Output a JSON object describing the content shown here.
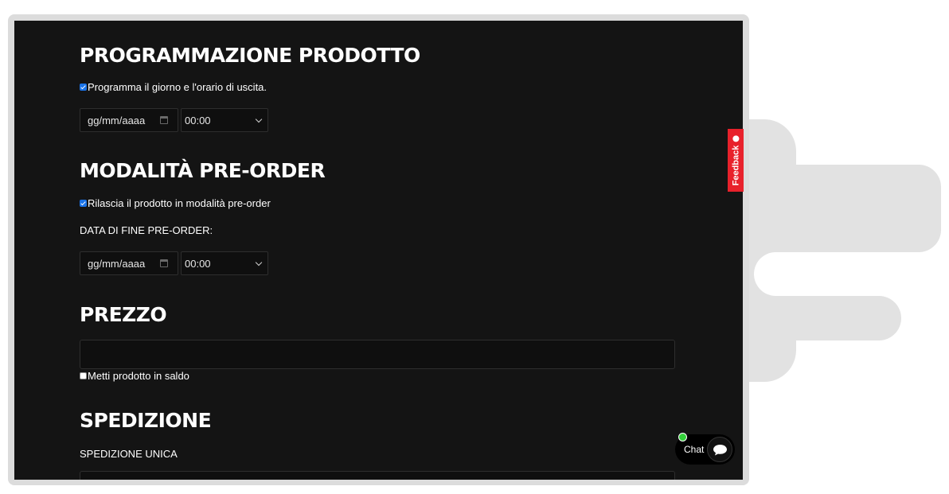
{
  "sections": {
    "scheduling": {
      "title": "PROGRAMMAZIONE PRODOTTO",
      "checkbox_label": "Programma il giorno e l'orario di uscita.",
      "checkbox_checked": true,
      "date_placeholder": "gg/mm/aaaa",
      "time_value": "00:00"
    },
    "preorder": {
      "title": "MODALITÀ PRE-ORDER",
      "checkbox_label": "Rilascia il prodotto in modalità pre-order",
      "checkbox_checked": true,
      "end_date_label": "DATA DI FINE PRE-ORDER:",
      "date_placeholder": "gg/mm/aaaa",
      "time_value": "00:00"
    },
    "price": {
      "title": "PREZZO",
      "value": "",
      "sale_checkbox_label": "Metti prodotto in saldo",
      "sale_checked": false
    },
    "shipping": {
      "title": "SPEDIZIONE",
      "single_label": "SPEDIZIONE UNICA"
    }
  },
  "feedback_tab": {
    "label": "Feedback",
    "color": "#e8212b"
  },
  "chat_widget": {
    "label": "Chat",
    "status_color": "#33d13a",
    "icon": "chat-bubble-icon"
  },
  "theme": {
    "page_background": "#141414",
    "checkbox_accent": "#1a73e8"
  }
}
